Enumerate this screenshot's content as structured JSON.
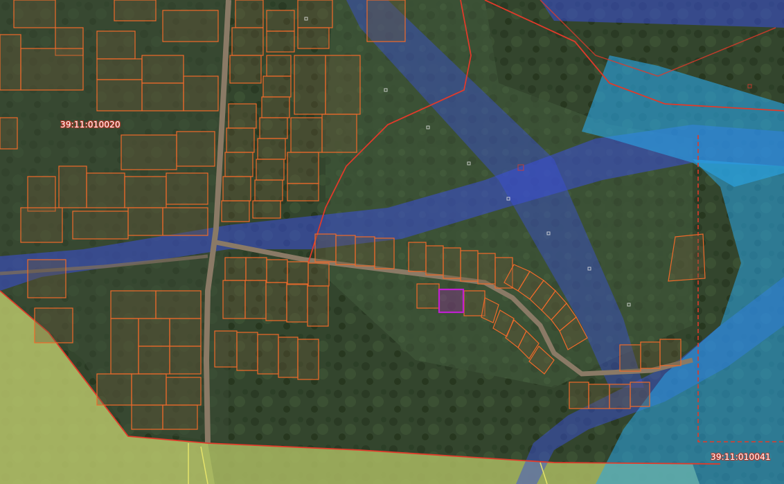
{
  "map": {
    "cadastral_blocks": [
      {
        "id": "block-west",
        "label": "39:11:010020"
      },
      {
        "id": "block-southeast",
        "label": "39:11:010041"
      }
    ],
    "colors": {
      "background_forest": "#2f3f2a",
      "field_yellow_green": "#b7c46a",
      "block_boundary": "#e03a2a",
      "parcel_outline": "#f06a2a",
      "parcel_fill": "#6b5a3a",
      "selected_parcel": "#c020d0",
      "zone_blue": "#3a4fd8",
      "zone_light_blue": "#2aa6e8",
      "road": "#8a7a66"
    },
    "selected_parcel_present": true
  }
}
